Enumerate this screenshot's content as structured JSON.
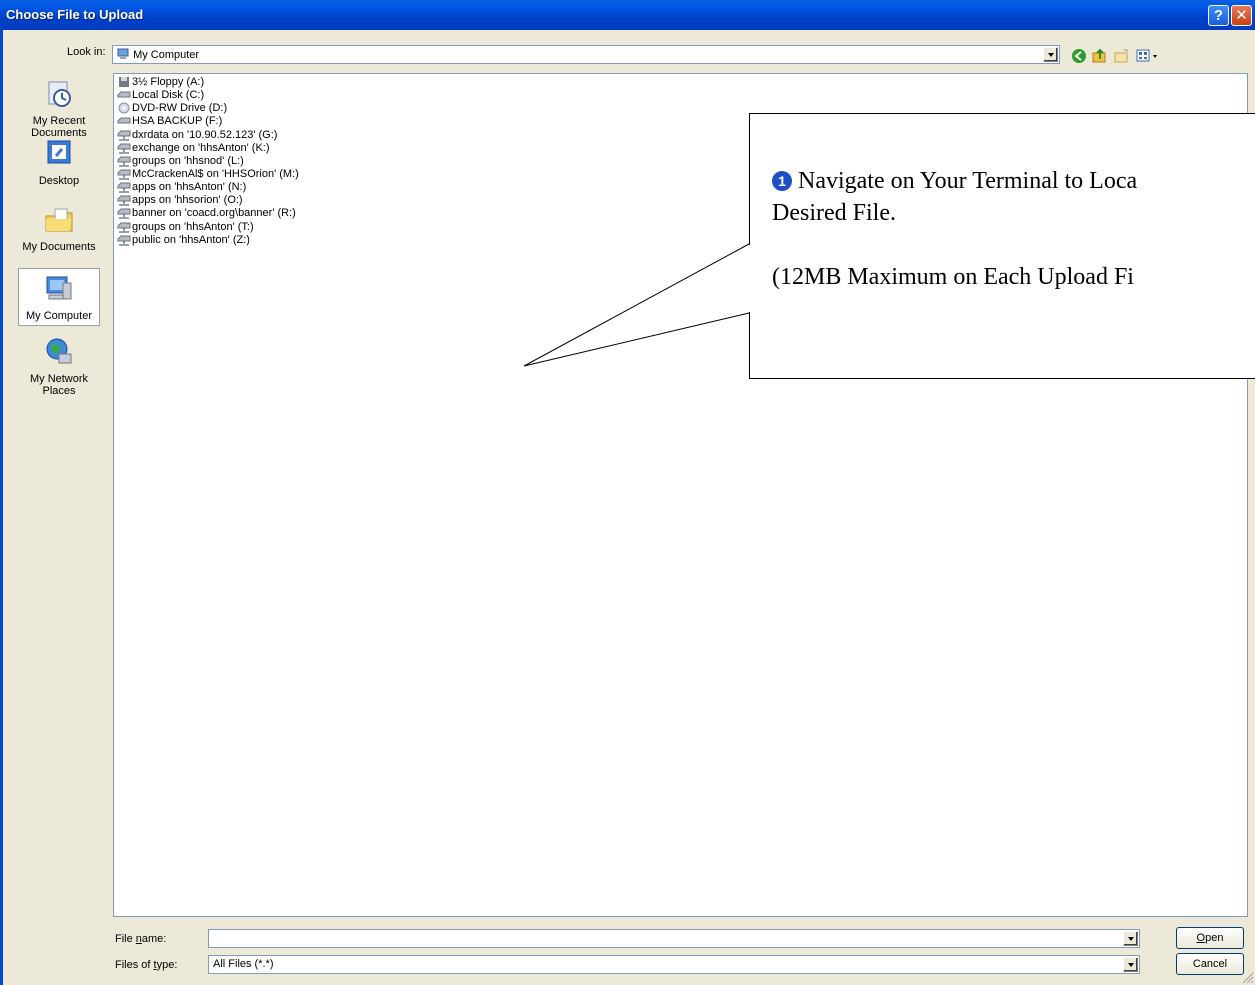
{
  "window": {
    "title": "Choose File to Upload",
    "help": "?",
    "close": "✕"
  },
  "lookin": {
    "label": "Look in:",
    "value": "My Computer"
  },
  "places": [
    {
      "label": "My Recent Documents",
      "icon": "recent-documents-icon"
    },
    {
      "label": "Desktop",
      "icon": "desktop-icon"
    },
    {
      "label": "My Documents",
      "icon": "my-documents-icon"
    },
    {
      "label": "My Computer",
      "icon": "my-computer-icon"
    },
    {
      "label": "My Network Places",
      "icon": "network-places-icon"
    }
  ],
  "files": [
    {
      "label": "3½ Floppy (A:)",
      "icon": "floppy-drive-icon"
    },
    {
      "label": "Local Disk (C:)",
      "icon": "hard-disk-icon"
    },
    {
      "label": "DVD-RW Drive (D:)",
      "icon": "dvd-drive-icon"
    },
    {
      "label": "HSA BACKUP (F:)",
      "icon": "hard-disk-icon"
    },
    {
      "label": "dxrdata on '10.90.52.123' (G:)",
      "icon": "network-drive-icon"
    },
    {
      "label": "exchange on 'hhsAnton' (K:)",
      "icon": "network-drive-icon"
    },
    {
      "label": "groups on 'hhsnod' (L:)",
      "icon": "network-drive-icon"
    },
    {
      "label": "McCrackenAl$ on 'HHSOrion' (M:)",
      "icon": "network-drive-icon"
    },
    {
      "label": "apps on 'hhsAnton' (N:)",
      "icon": "network-drive-icon"
    },
    {
      "label": "apps on 'hhsorion' (O:)",
      "icon": "network-drive-icon"
    },
    {
      "label": "banner on 'coacd.org\\banner' (R:)",
      "icon": "network-drive-icon"
    },
    {
      "label": "groups on 'hhsAnton' (T:)",
      "icon": "network-drive-icon"
    },
    {
      "label": "public on 'hhsAnton' (Z:)",
      "icon": "network-drive-icon"
    }
  ],
  "filename": {
    "label_pre": "File ",
    "label_ul": "n",
    "label_post": "ame:",
    "value": ""
  },
  "filetype": {
    "label_pre": "Files of ",
    "label_ul": "t",
    "label_post": "ype:",
    "value": "All Files (*.*)"
  },
  "buttons": {
    "open_ul": "O",
    "open_rest": "pen",
    "cancel": "Cancel"
  },
  "callout": {
    "badge": "1",
    "line1": "Navigate on Your Terminal to Loca",
    "line2": "Desired File.",
    "line3": "(12MB Maximum on Each Upload Fi"
  },
  "colors": {
    "titlebar": "#0054e3",
    "dialog": "#ece9d8",
    "badge": "#1f4ec8"
  }
}
